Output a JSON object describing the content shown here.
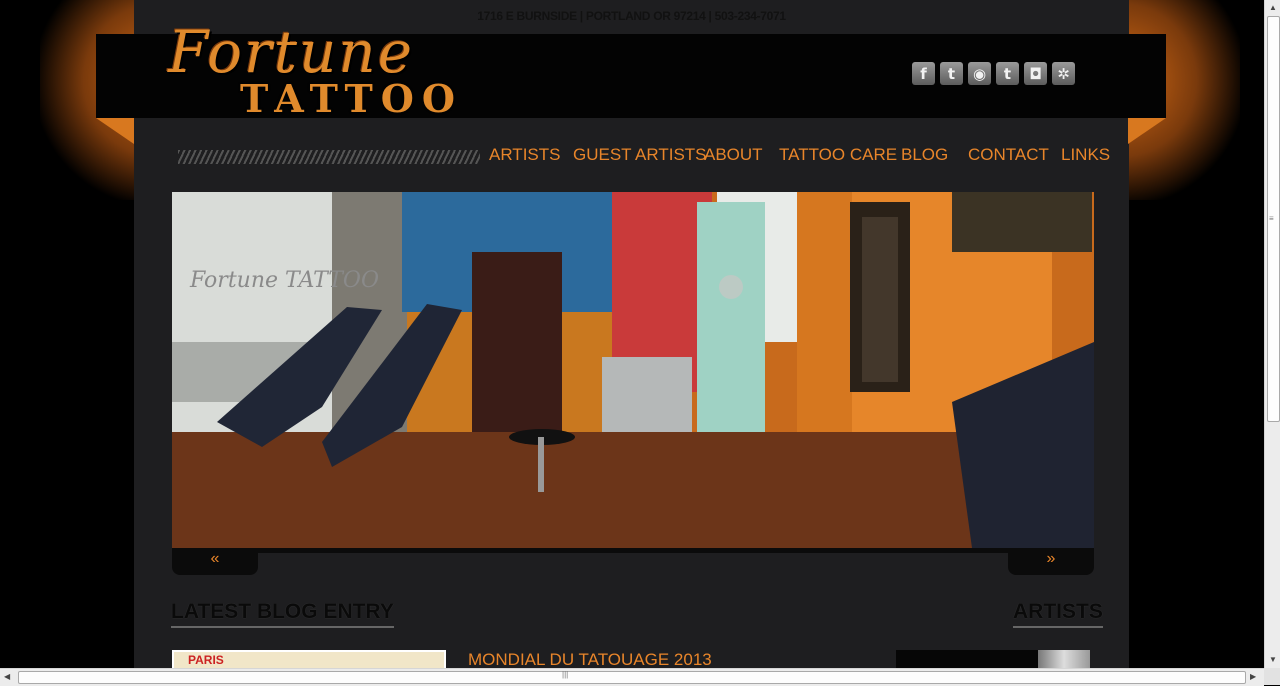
{
  "header": {
    "address": "1716 E BURNSIDE | PORTLAND OR 97214 | 503-234-7071",
    "logo_top": "Fortune",
    "logo_bottom": "TATTOO"
  },
  "social": [
    {
      "name": "facebook-icon",
      "glyph": "f"
    },
    {
      "name": "tumblr-icon",
      "glyph": "t"
    },
    {
      "name": "rss-icon",
      "glyph": "◉"
    },
    {
      "name": "twitter-icon",
      "glyph": "t"
    },
    {
      "name": "instagram-icon",
      "glyph": "◘"
    },
    {
      "name": "yelp-icon",
      "glyph": "✲"
    }
  ],
  "nav": {
    "artists": "Artists",
    "guest_artists": "Guest Artists",
    "about": "About",
    "tattoo_care": "Tattoo Care",
    "blog": "Blog",
    "contact": "Contact",
    "links": "Links"
  },
  "slider": {
    "prev": "«",
    "next": "»",
    "window_logo": "Fortune TATTOO"
  },
  "sections": {
    "blog_heading": "LATEST BLOG ENTRY",
    "artists_heading": "ARTISTS",
    "blog_post_title": "Mondial du Tatouage 2013",
    "blog_thumb_text": "PARIS"
  },
  "colors": {
    "accent": "#e8852a",
    "page_bg": "#1e1e20",
    "header_band": "#030303"
  }
}
